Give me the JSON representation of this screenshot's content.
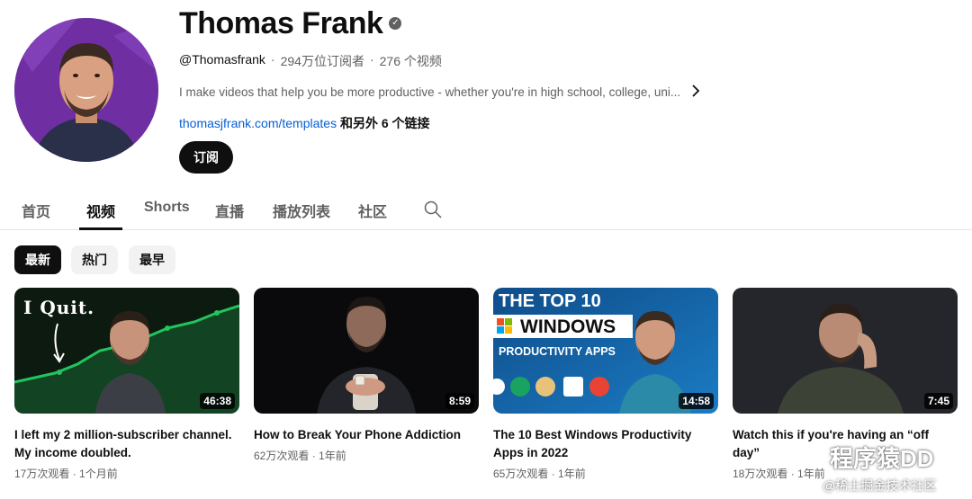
{
  "channel": {
    "name": "Thomas Frank",
    "handle": "@Thomasfrank",
    "subscribers": "294万位订阅者",
    "video_count": "276 个视频",
    "description": "I make videos that help you be more productive - whether you're in high school, college, uni...",
    "link_url": "thomasjfrank.com/templates",
    "link_more": "和另外 6 个链接",
    "subscribe_label": "订阅",
    "separator": "·",
    "verified_icon": "check-icon"
  },
  "tabs": [
    {
      "label": "首页"
    },
    {
      "label": "视频"
    },
    {
      "label": "Shorts"
    },
    {
      "label": "直播"
    },
    {
      "label": "播放列表"
    },
    {
      "label": "社区"
    }
  ],
  "filters": [
    {
      "label": "最新"
    },
    {
      "label": "热门"
    },
    {
      "label": "最早"
    }
  ],
  "videos": [
    {
      "title": "I left my 2 million-subscriber channel. My income doubled.",
      "duration": "46:38",
      "views": "17万次观看",
      "age": "1个月前",
      "thumb_text": "I Quit."
    },
    {
      "title": "How to Break Your Phone Addiction",
      "duration": "8:59",
      "views": "62万次观看",
      "age": "1年前"
    },
    {
      "title": "The 10 Best Windows Productivity Apps in 2022",
      "duration": "14:58",
      "views": "65万次观看",
      "age": "1年前",
      "thumb_line1": "THE TOP 10",
      "thumb_line2": "WINDOWS",
      "thumb_line3": "PRODUCTIVITY APPS"
    },
    {
      "title": "Watch this if you're having an “off day”",
      "duration": "7:45",
      "views": "18万次观看",
      "age": "1年前"
    }
  ],
  "watermark": {
    "brand": "程序猿DD",
    "site": "@稀土掘金技术社区"
  },
  "colors": {
    "link": "#065fd4",
    "primary_text": "#0f0f0f",
    "secondary_text": "#606060",
    "chip_active_bg": "#0f0f0f",
    "chip_bg": "#f2f2f2",
    "avatar_bg": "#6f2fa3",
    "chart_green": "#22c55e"
  }
}
